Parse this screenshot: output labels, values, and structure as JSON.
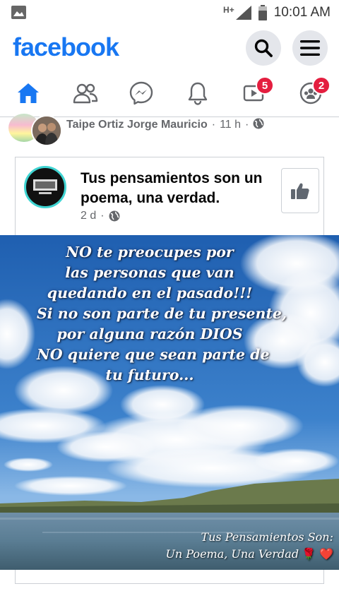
{
  "status_bar": {
    "network_type": "H+",
    "time": "10:01 AM",
    "icons": [
      "image-icon",
      "signal-icon",
      "battery-icon"
    ]
  },
  "header": {
    "logo": "facebook",
    "brand_color": "#1877f2",
    "buttons": [
      "search-icon",
      "menu-icon"
    ]
  },
  "nav": {
    "items": [
      {
        "name": "home",
        "icon": "home-icon",
        "active": true
      },
      {
        "name": "friends",
        "icon": "friends-icon"
      },
      {
        "name": "messenger",
        "icon": "messenger-icon"
      },
      {
        "name": "notifications",
        "icon": "bell-icon"
      },
      {
        "name": "watch",
        "icon": "watch-icon",
        "badge": "5"
      },
      {
        "name": "groups",
        "icon": "groups-icon",
        "badge": "2"
      }
    ]
  },
  "post": {
    "sharer_name": "Taipe Ortiz Jorge Mauricio",
    "sharer_time": "11 h",
    "shared": {
      "page_name": "Tus pensamientos son un poema, una verdad.",
      "time": "2 d",
      "like_button_icon": "thumbs-up-icon",
      "image": {
        "quote_lines": [
          "NO  te preocupes por",
          "las personas que van",
          "quedando en el pasado!!!",
          "Si no son parte de tu presente,",
          "por alguna razón DIOS",
          "NO quiere que sean parte de",
          "tu futuro..."
        ],
        "watermark_line1": "Tus Pensamientos Son:",
        "watermark_line2": "Un Poema, Una Verdad",
        "watermark_icons": "🌹 ❤️"
      }
    }
  }
}
